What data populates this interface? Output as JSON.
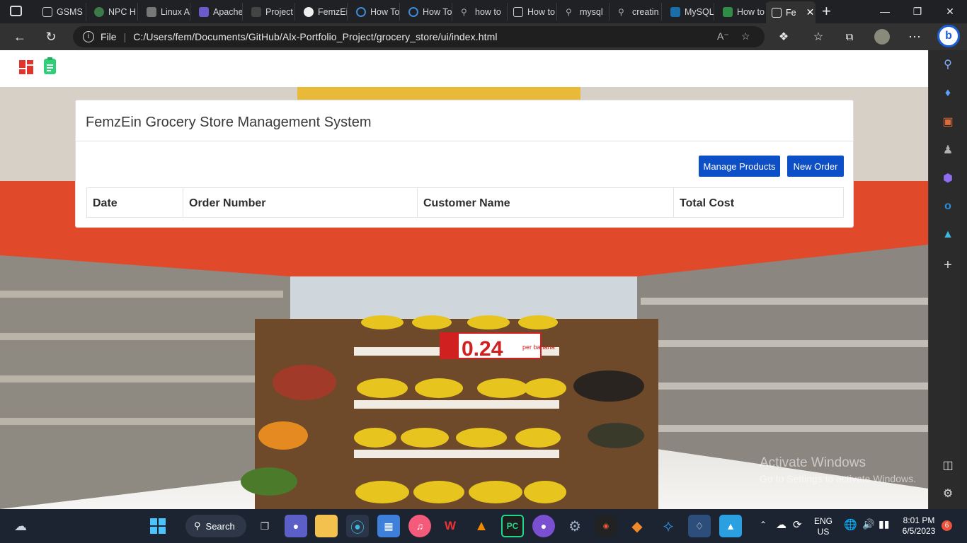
{
  "browser": {
    "tabs": [
      {
        "label": "GSMS"
      },
      {
        "label": "NPC H"
      },
      {
        "label": "Linux A"
      },
      {
        "label": "Apache"
      },
      {
        "label": "Project"
      },
      {
        "label": "FemzEi"
      },
      {
        "label": "How To"
      },
      {
        "label": "How To"
      },
      {
        "label": "how to"
      },
      {
        "label": "How to"
      },
      {
        "label": "mysql"
      },
      {
        "label": "creatin"
      },
      {
        "label": "MySQL"
      },
      {
        "label": "How to"
      },
      {
        "label": "Fe"
      }
    ],
    "address": {
      "scheme_label": "File",
      "url": "C:/Users/fem/Documents/GitHub/Alx-Portfolio_Project/grocery_store/ui/index.html"
    }
  },
  "app": {
    "title": "FemzEin Grocery Store Management System",
    "buttons": {
      "manage_products": "Manage Products",
      "new_order": "New Order"
    },
    "table": {
      "columns": [
        "Date",
        "Order Number",
        "Customer Name",
        "Total Cost"
      ],
      "rows": []
    },
    "background": {
      "price_sign_value": "0.24",
      "price_sign_unit": "per banana"
    }
  },
  "watermark": {
    "line1": "Activate Windows",
    "line2": "Go to Settings to activate Windows."
  },
  "taskbar": {
    "search_label": "Search",
    "language": "ENG",
    "region": "US",
    "time": "8:01 PM",
    "date": "6/5/2023",
    "notification_count": "6"
  },
  "colors": {
    "primary_button": "#0d4fc7",
    "browser_chrome": "#323232",
    "taskbar": "#1c2431"
  }
}
